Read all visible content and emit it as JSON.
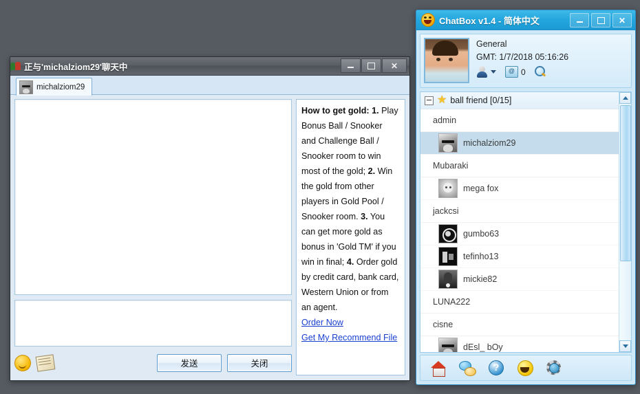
{
  "chat_window": {
    "title": "正与'michalziom29'聊天中",
    "icon": "two-people-icon",
    "controls": {
      "minimize": "–",
      "maximize": "□",
      "close": "X"
    },
    "tab": {
      "label": "michalziom29",
      "avatar": "user-avatar"
    },
    "log": {
      "messages": []
    },
    "input": {
      "value": "",
      "placeholder": ""
    },
    "toolbar": {
      "emoji_icon": "smiley-icon",
      "notepad_icon": "notepad-icon",
      "send_label": "发送",
      "close_label": "关闭"
    },
    "gold_panel": {
      "heading": "How to get gold:",
      "items": [
        {
          "num": "1.",
          "text": " Play Bonus Ball / Snooker and Challenge Ball / Snooker room to win most of the gold;"
        },
        {
          "num": "2.",
          "text": " Win the gold from other players in Gold Pool / Snooker room."
        },
        {
          "num": "3.",
          "text": " You can get more gold as bonus in 'Gold TM' if you win in final;"
        },
        {
          "num": "4.",
          "text": " Order gold by credit card, bank card, Western Union or from an agent."
        }
      ],
      "links": [
        "Order Now",
        "Get My Recommend File"
      ]
    }
  },
  "chatbox_window": {
    "title": "ChatBox v1.4 - 简体中文",
    "logo_icon": "laughing-face-icon",
    "controls": {
      "minimize": "–",
      "maximize": "□",
      "close": "X"
    },
    "profile": {
      "avatar": "boy-cartoon-avatar",
      "name": "General",
      "gmt": "GMT: 1/7/2018 05:16:26",
      "icons": [
        {
          "name": "person-status-icon",
          "label": ""
        },
        {
          "name": "mailbox-icon",
          "label": "0"
        },
        {
          "name": "search-magnifier-icon",
          "label": ""
        }
      ]
    },
    "friend_list": {
      "group": {
        "expander": "collapse-box",
        "star": "★",
        "label": "ball friend [0/15]"
      },
      "rows": [
        {
          "type": "section",
          "label": "admin"
        },
        {
          "type": "friend",
          "label": "michalziom29",
          "avatar": "a1",
          "selected": true
        },
        {
          "type": "section",
          "label": "Mubaraki"
        },
        {
          "type": "friend",
          "label": "mega fox",
          "avatar": "a2",
          "selected": false
        },
        {
          "type": "section",
          "label": "jackcsi"
        },
        {
          "type": "friend",
          "label": "gumbo63",
          "avatar": "a3",
          "selected": false
        },
        {
          "type": "friend",
          "label": "tefinho13",
          "avatar": "a4",
          "selected": false
        },
        {
          "type": "friend",
          "label": "mickie82",
          "avatar": "a5",
          "selected": false
        },
        {
          "type": "section",
          "label": "LUNA222"
        },
        {
          "type": "section",
          "label": "cisne"
        },
        {
          "type": "friend",
          "label": "dEsl_ bOy",
          "avatar": "a6",
          "selected": false
        }
      ],
      "scrollbar": {
        "up": "▲",
        "down": "▼"
      }
    },
    "bottom_toolbar": [
      {
        "name": "home-icon"
      },
      {
        "name": "chat-bubbles-icon"
      },
      {
        "name": "help-question-icon"
      },
      {
        "name": "smiley-icon"
      },
      {
        "name": "settings-gear-icon"
      }
    ]
  },
  "colors": {
    "desktop": "#565b61",
    "chatbox_accent": "#23a6de",
    "selection": "#c4dcec",
    "link": "#1a3fd0"
  }
}
